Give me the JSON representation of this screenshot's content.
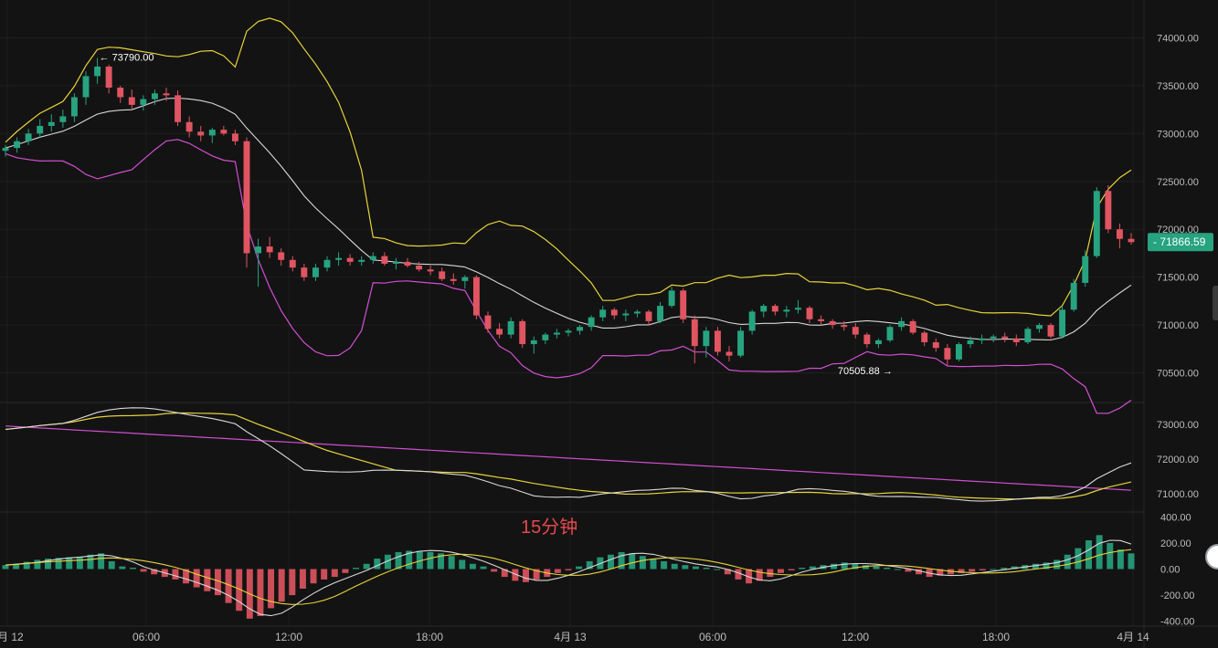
{
  "chart_data": [
    {
      "type": "candlestick",
      "title": "",
      "overlays": [
        "Bollinger upper (yellow)",
        "Bollinger middle (white)",
        "Bollinger lower (magenta)"
      ],
      "y_ticks": [
        "74000.00",
        "73500.00",
        "73000.00",
        "72500.00",
        "72000.00",
        "71500.00",
        "71000.00",
        "70500.00"
      ],
      "ylim": [
        70200,
        74300
      ],
      "last_price": "71866.59",
      "high_marker": "73790.00",
      "low_marker": "70505.88",
      "x_ticks": [
        "4月 12",
        "06:00",
        "12:00",
        "18:00",
        "4月 13",
        "06:00",
        "12:00",
        "18:00",
        "4月 14"
      ],
      "ohlc": [
        [
          72820,
          72880,
          72760,
          72850
        ],
        [
          72850,
          72960,
          72800,
          72920
        ],
        [
          72920,
          73050,
          72880,
          73000
        ],
        [
          73000,
          73150,
          72960,
          73080
        ],
        [
          73080,
          73200,
          73020,
          73120
        ],
        [
          73120,
          73250,
          73060,
          73180
        ],
        [
          73180,
          73420,
          73120,
          73380
        ],
        [
          73380,
          73650,
          73300,
          73600
        ],
        [
          73600,
          73790,
          73520,
          73700
        ],
        [
          73700,
          73720,
          73420,
          73480
        ],
        [
          73480,
          73500,
          73320,
          73380
        ],
        [
          73380,
          73460,
          73260,
          73300
        ],
        [
          73300,
          73400,
          73240,
          73360
        ],
        [
          73360,
          73460,
          73300,
          73420
        ],
        [
          73420,
          73480,
          73340,
          73400
        ],
        [
          73400,
          73450,
          73080,
          73120
        ],
        [
          73120,
          73180,
          72960,
          73020
        ],
        [
          73020,
          73080,
          72920,
          72980
        ],
        [
          72980,
          73060,
          72900,
          73040
        ],
        [
          73040,
          73080,
          72980,
          73000
        ],
        [
          73000,
          73040,
          72880,
          72920
        ],
        [
          72920,
          72960,
          71600,
          71750
        ],
        [
          71750,
          71900,
          71400,
          71820
        ],
        [
          71820,
          71920,
          71700,
          71760
        ],
        [
          71760,
          71800,
          71620,
          71680
        ],
        [
          71680,
          71720,
          71560,
          71600
        ],
        [
          71600,
          71640,
          71460,
          71500
        ],
        [
          71500,
          71640,
          71460,
          71600
        ],
        [
          71600,
          71720,
          71560,
          71680
        ],
        [
          71680,
          71760,
          71620,
          71700
        ],
        [
          71700,
          71740,
          71620,
          71660
        ],
        [
          71660,
          71720,
          71620,
          71680
        ],
        [
          71680,
          71760,
          71640,
          71720
        ],
        [
          71720,
          71760,
          71620,
          71640
        ],
        [
          71640,
          71700,
          71580,
          71660
        ],
        [
          71660,
          71700,
          71600,
          71620
        ],
        [
          71620,
          71660,
          71560,
          71580
        ],
        [
          71580,
          71620,
          71520,
          71560
        ],
        [
          71560,
          71600,
          71460,
          71480
        ],
        [
          71480,
          71540,
          71420,
          71460
        ],
        [
          71460,
          71520,
          71380,
          71500
        ],
        [
          71500,
          71520,
          71060,
          71100
        ],
        [
          71100,
          71140,
          70920,
          70960
        ],
        [
          70960,
          71020,
          70860,
          70900
        ],
        [
          70900,
          71080,
          70860,
          71040
        ],
        [
          71040,
          71060,
          70760,
          70800
        ],
        [
          70800,
          70880,
          70700,
          70840
        ],
        [
          70840,
          70920,
          70800,
          70900
        ],
        [
          70900,
          70960,
          70860,
          70920
        ],
        [
          70920,
          70960,
          70880,
          70940
        ],
        [
          70940,
          71000,
          70900,
          70980
        ],
        [
          70980,
          71100,
          70940,
          71080
        ],
        [
          71080,
          71200,
          71040,
          71160
        ],
        [
          71160,
          71180,
          71060,
          71100
        ],
        [
          71100,
          71160,
          71040,
          71120
        ],
        [
          71120,
          71160,
          71080,
          71140
        ],
        [
          71140,
          71160,
          71000,
          71040
        ],
        [
          71040,
          71240,
          71020,
          71200
        ],
        [
          71200,
          71400,
          71180,
          71360
        ],
        [
          71360,
          71380,
          71020,
          71060
        ],
        [
          71060,
          71100,
          70600,
          70780
        ],
        [
          70780,
          70980,
          70660,
          70940
        ],
        [
          70940,
          70980,
          70680,
          70720
        ],
        [
          70720,
          70780,
          70620,
          70680
        ],
        [
          70680,
          70980,
          70660,
          70940
        ],
        [
          70940,
          71160,
          70900,
          71140
        ],
        [
          71140,
          71220,
          71080,
          71200
        ],
        [
          71200,
          71220,
          71100,
          71140
        ],
        [
          71140,
          71200,
          71080,
          71160
        ],
        [
          71160,
          71260,
          71120,
          71180
        ],
        [
          71180,
          71200,
          71020,
          71060
        ],
        [
          71060,
          71100,
          71000,
          71040
        ],
        [
          71040,
          71060,
          70960,
          71000
        ],
        [
          71000,
          71040,
          70940,
          70980
        ],
        [
          70980,
          71020,
          70860,
          70900
        ],
        [
          70900,
          70920,
          70760,
          70800
        ],
        [
          70800,
          70860,
          70760,
          70840
        ],
        [
          70840,
          71000,
          70820,
          70980
        ],
        [
          70980,
          71080,
          70940,
          71040
        ],
        [
          71040,
          71060,
          70900,
          70920
        ],
        [
          70920,
          70940,
          70780,
          70820
        ],
        [
          70820,
          70860,
          70720,
          70760
        ],
        [
          70760,
          70800,
          70580,
          70640
        ],
        [
          70640,
          70820,
          70620,
          70800
        ],
        [
          70800,
          70880,
          70760,
          70840
        ],
        [
          70840,
          70900,
          70800,
          70860
        ],
        [
          70860,
          70900,
          70820,
          70880
        ],
        [
          70880,
          70920,
          70820,
          70860
        ],
        [
          70860,
          70900,
          70780,
          70820
        ],
        [
          70820,
          70980,
          70800,
          70960
        ],
        [
          70960,
          71020,
          70920,
          71000
        ],
        [
          71000,
          71020,
          70860,
          70880
        ],
        [
          70880,
          71200,
          70860,
          71160
        ],
        [
          71160,
          71480,
          71140,
          71440
        ],
        [
          71440,
          71780,
          71400,
          71720
        ],
        [
          71720,
          72440,
          71700,
          72400
        ],
        [
          72400,
          72460,
          71960,
          72000
        ],
        [
          72000,
          72060,
          71800,
          71900
        ],
        [
          71900,
          71960,
          71840,
          71866
        ]
      ]
    },
    {
      "type": "line",
      "title": "",
      "y_ticks": [
        "73000.00",
        "72000.00",
        "71000.00"
      ],
      "ylim": [
        70500,
        73600
      ],
      "series_colors": [
        "#d8d8d8",
        "#e6d33a",
        "#d14fd1"
      ]
    },
    {
      "type": "bar",
      "title": "",
      "y_ticks": [
        "400.00",
        "200.00",
        "0.00",
        "-200.00",
        "-400.00"
      ],
      "ylim": [
        -430,
        430
      ],
      "annotation": "15分钟",
      "histogram": [
        30,
        40,
        55,
        70,
        80,
        85,
        90,
        95,
        110,
        120,
        60,
        20,
        10,
        -20,
        -40,
        -60,
        -80,
        -110,
        -140,
        -170,
        -200,
        -260,
        -320,
        -380,
        -360,
        -300,
        -250,
        -200,
        -150,
        -110,
        -80,
        -60,
        -30,
        10,
        40,
        80,
        110,
        130,
        140,
        140,
        130,
        120,
        100,
        70,
        40,
        20,
        -20,
        -60,
        -90,
        -100,
        -80,
        -60,
        -30,
        -10,
        20,
        60,
        90,
        110,
        130,
        120,
        100,
        80,
        60,
        40,
        30,
        20,
        10,
        0,
        -40,
        -80,
        -110,
        -90,
        -60,
        -30,
        -10,
        10,
        20,
        30,
        40,
        50,
        40,
        30,
        20,
        10,
        0,
        -20,
        -40,
        -60,
        -50,
        -40,
        -30,
        -20,
        -10,
        0,
        10,
        20,
        30,
        40,
        50,
        70,
        110,
        160,
        220,
        260,
        200,
        150,
        120
      ],
      "line_colors": [
        "#d8d8d8",
        "#e6d33a"
      ]
    }
  ],
  "colors": {
    "up": "#27a380",
    "down": "#e05561",
    "upper": "#e6d33a",
    "mid": "#d8d8d8",
    "lower": "#d14fd1",
    "price_tag_bg": "#27a380",
    "annotation": "#e5494d"
  }
}
